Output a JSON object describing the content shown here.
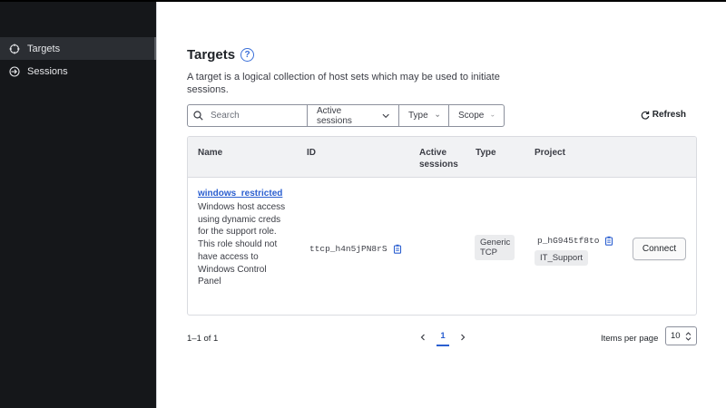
{
  "sidebar": {
    "items": [
      {
        "label": "Targets",
        "icon": "crosshair-icon",
        "active": true
      },
      {
        "label": "Sessions",
        "icon": "sign-in-icon",
        "active": false
      }
    ]
  },
  "page": {
    "title": "Targets",
    "help_icon_glyph": "?",
    "description": "A target is a logical collection of host sets which may be used to initiate sessions."
  },
  "filters": {
    "search_placeholder": "Search",
    "active_sessions_label": "Active sessions",
    "type_label": "Type",
    "scope_label": "Scope"
  },
  "refresh_label": "Refresh",
  "table": {
    "headers": {
      "name": "Name",
      "id": "ID",
      "active_sessions_line1": "Active",
      "active_sessions_line2": "sessions",
      "type": "Type",
      "project": "Project"
    },
    "rows": [
      {
        "name": "windows_restricted",
        "description": "Windows host access using dynamic creds for the support role. This role should not have access to Windows Control Panel",
        "id": "ttcp_h4n5jPN8rS",
        "type_line1": "Generic",
        "type_line2": "TCP",
        "project_id": "p_hG945tf8to",
        "project_name": "IT_Support",
        "action": "Connect"
      }
    ]
  },
  "pagination": {
    "summary": "1–1 of 1",
    "current_page": "1",
    "items_per_page_label": "Items per page",
    "items_per_page_value": "10"
  },
  "colors": {
    "accent": "#2b5fd0",
    "sidebar_bg": "#15171a"
  }
}
